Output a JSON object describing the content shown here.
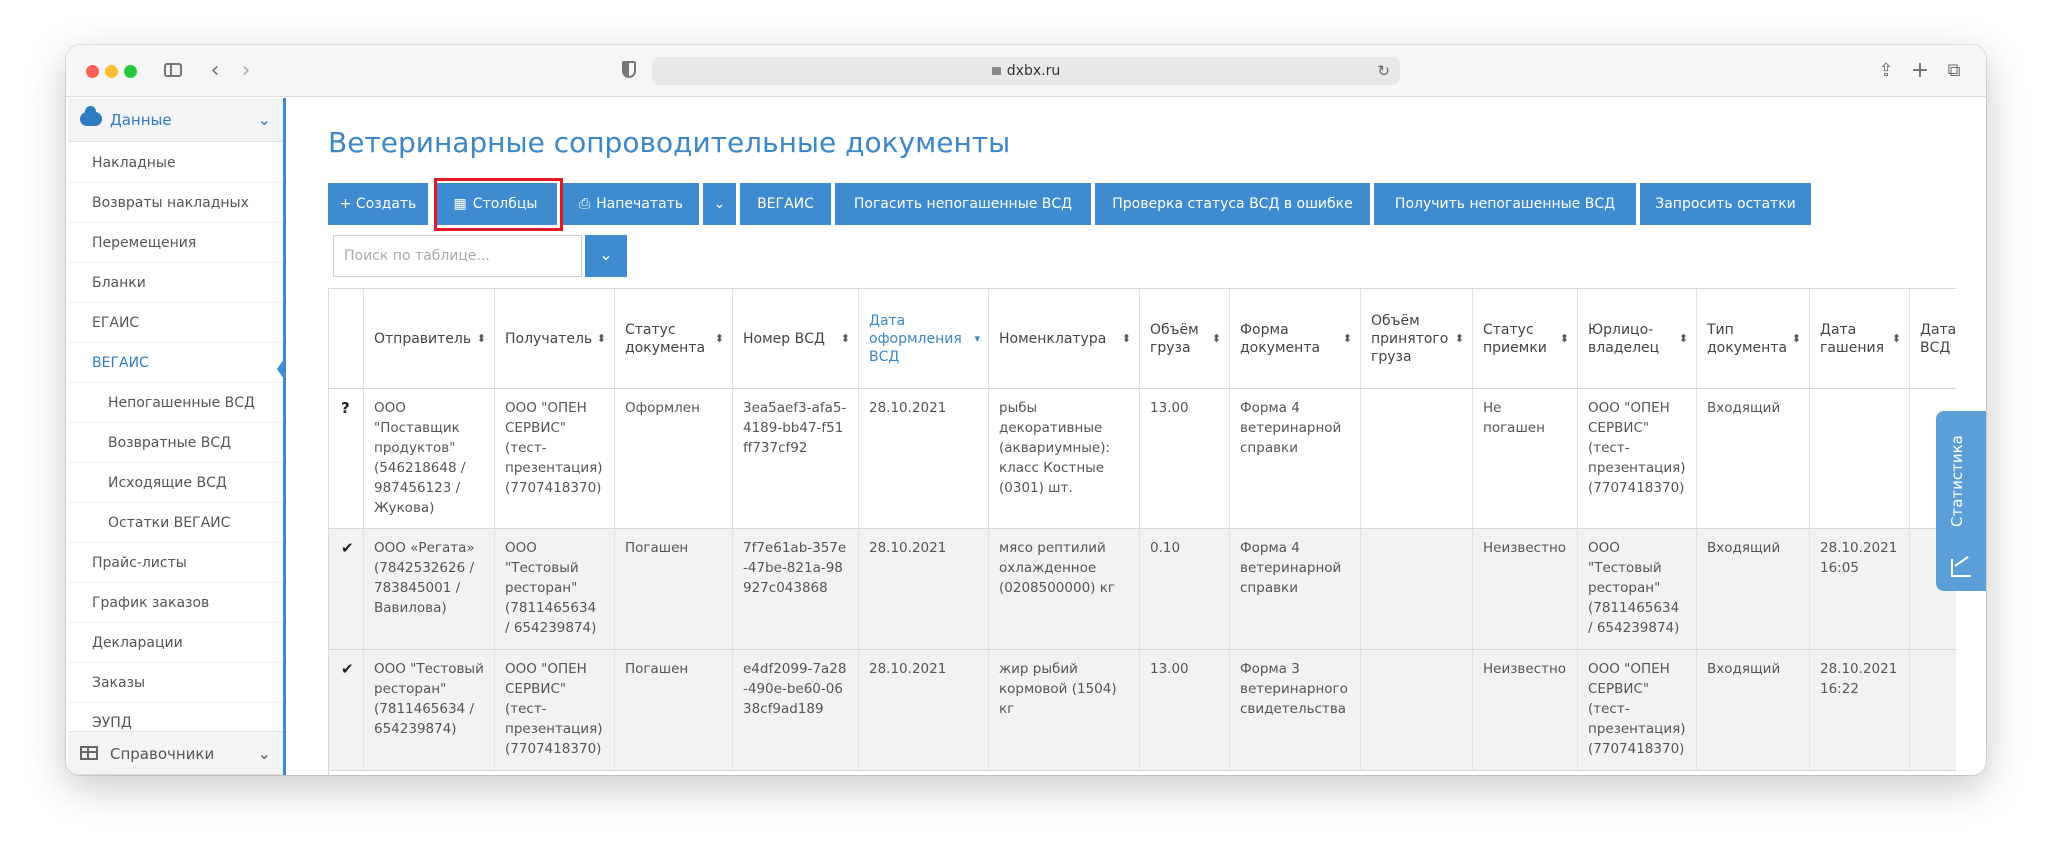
{
  "browser": {
    "url": "dxbx.ru"
  },
  "sidebar": {
    "section_data": "Данные",
    "items": [
      {
        "label": "Накладные"
      },
      {
        "label": "Возвраты накладных"
      },
      {
        "label": "Перемещения"
      },
      {
        "label": "Бланки"
      },
      {
        "label": "ЕГАИС"
      },
      {
        "label": "ВЕГАИС"
      },
      {
        "label": "Непогашенные ВСД"
      },
      {
        "label": "Возвратные ВСД"
      },
      {
        "label": "Исходящие ВСД"
      },
      {
        "label": "Остатки ВЕГАИС"
      },
      {
        "label": "Прайс-листы"
      },
      {
        "label": "График заказов"
      },
      {
        "label": "Декларации"
      },
      {
        "label": "Заказы"
      },
      {
        "label": "ЭУПД"
      }
    ],
    "section_refs": "Справочники"
  },
  "page": {
    "title": "Ветеринарные сопроводительные документы"
  },
  "toolbar": {
    "create": "+ Создать",
    "columns": "Столбцы",
    "print": "Напечатать",
    "vegais": "ВЕГАИС",
    "redeem": "Погасить непогашенные ВСД",
    "check_status": "Проверка статуса ВСД в ошибке",
    "get_unredeemed": "Получить непогашенные ВСД",
    "request_balance": "Запросить остатки"
  },
  "search": {
    "placeholder": "Поиск по таблице..."
  },
  "table": {
    "headers": [
      "",
      "Отправитель",
      "Получатель",
      "Статус документа",
      "Номер ВСД",
      "Дата оформления ВСД",
      "Номенклатура",
      "Объём груза",
      "Форма документа",
      "Объём принятого груза",
      "Статус приемки",
      "Юрлицо-владелец",
      "Тип документа",
      "Дата гашения",
      "Дата отпр ВСД ВЕТ"
    ],
    "rows": [
      [
        "?",
        "ООО \"Поставщик продуктов\" (546218648 / 987456123 / Жукова)",
        "ООО \"ОПЕН СЕРВИС\" (тест-презентация) (7707418370)",
        "Оформлен",
        "3ea5aef3-afa5-4189-bb47-f51ff737cf92",
        "28.10.2021",
        "рыбы декоративные (аквариумные): класс Костные (0301) шт.",
        "13.00",
        "Форма 4 ветеринарной справки",
        "",
        "Не погашен",
        "ООО \"ОПЕН СЕРВИС\" (тест-презентация) (7707418370)",
        "Входящий",
        "",
        ""
      ],
      [
        "✔",
        "ООО «Регата» (7842532626 / 783845001 / Вавилова)",
        "ООО \"Тестовый ресторан\" (7811465634 / 654239874)",
        "Погашен",
        "7f7e61ab-357e-47be-821a-98927c043868",
        "28.10.2021",
        "мясо рептилий охлажденное (0208500000) кг",
        "0.10",
        "Форма 4 ветеринарной справки",
        "",
        "Неизвестно",
        "ООО \"Тестовый ресторан\" (7811465634 / 654239874)",
        "Входящий",
        "28.10.2021 16:05",
        ""
      ],
      [
        "✔",
        "ООО \"Тестовый ресторан\" (7811465634 / 654239874)",
        "ООО \"ОПЕН СЕРВИС\" (тест-презентация) (7707418370)",
        "Погашен",
        "e4df2099-7a28-490e-be60-0638cf9ad189",
        "28.10.2021",
        "жир рыбий кормовой (1504) кг",
        "13.00",
        "Форма 3 ветеринарного свидетельства",
        "",
        "Неизвестно",
        "ООО \"ОПЕН СЕРВИС\" (тест-презентация) (7707418370)",
        "Входящий",
        "28.10.2021 16:22",
        ""
      ]
    ]
  },
  "stats_tab": {
    "label": "Статистика"
  }
}
